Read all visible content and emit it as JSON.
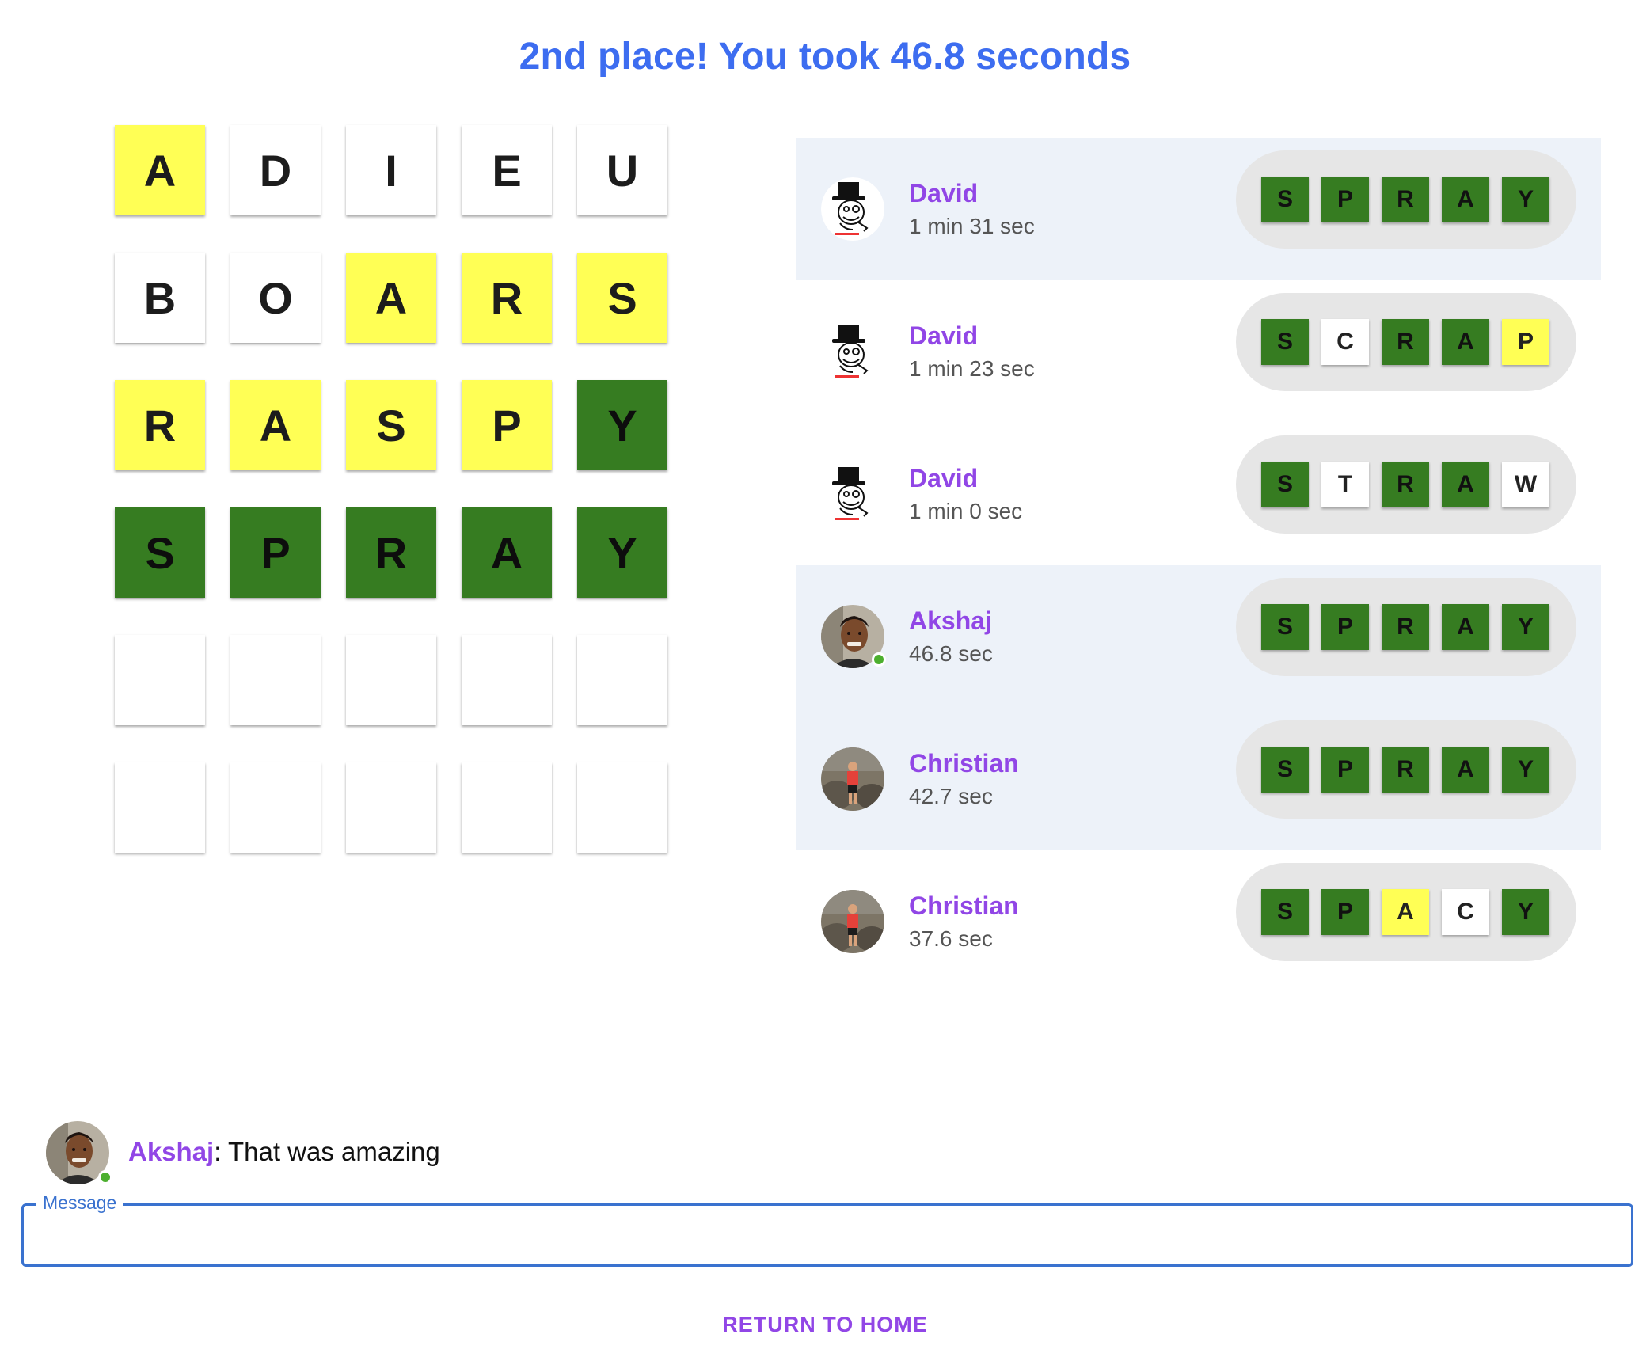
{
  "headline": "2nd place! You took 46.8 seconds",
  "board": [
    [
      {
        "l": "A",
        "s": "yellow"
      },
      {
        "l": "D",
        "s": "white"
      },
      {
        "l": "I",
        "s": "white"
      },
      {
        "l": "E",
        "s": "white"
      },
      {
        "l": "U",
        "s": "white"
      }
    ],
    [
      {
        "l": "B",
        "s": "white"
      },
      {
        "l": "O",
        "s": "white"
      },
      {
        "l": "A",
        "s": "yellow"
      },
      {
        "l": "R",
        "s": "yellow"
      },
      {
        "l": "S",
        "s": "yellow"
      }
    ],
    [
      {
        "l": "R",
        "s": "yellow"
      },
      {
        "l": "A",
        "s": "yellow"
      },
      {
        "l": "S",
        "s": "yellow"
      },
      {
        "l": "P",
        "s": "yellow"
      },
      {
        "l": "Y",
        "s": "green"
      }
    ],
    [
      {
        "l": "S",
        "s": "green"
      },
      {
        "l": "P",
        "s": "green"
      },
      {
        "l": "R",
        "s": "green"
      },
      {
        "l": "A",
        "s": "green"
      },
      {
        "l": "Y",
        "s": "green"
      }
    ],
    [
      {
        "l": "",
        "s": "white"
      },
      {
        "l": "",
        "s": "white"
      },
      {
        "l": "",
        "s": "white"
      },
      {
        "l": "",
        "s": "white"
      },
      {
        "l": "",
        "s": "white"
      }
    ],
    [
      {
        "l": "",
        "s": "white"
      },
      {
        "l": "",
        "s": "white"
      },
      {
        "l": "",
        "s": "white"
      },
      {
        "l": "",
        "s": "white"
      },
      {
        "l": "",
        "s": "white"
      }
    ]
  ],
  "results": [
    {
      "name": "David",
      "time": "1 min 31 sec",
      "avatar": "meme-avatar",
      "online": false,
      "highlight": true,
      "tiles": [
        {
          "l": "S",
          "s": "green"
        },
        {
          "l": "P",
          "s": "green"
        },
        {
          "l": "R",
          "s": "green"
        },
        {
          "l": "A",
          "s": "green"
        },
        {
          "l": "Y",
          "s": "green"
        }
      ]
    },
    {
      "name": "David",
      "time": "1 min 23 sec",
      "avatar": "meme-avatar",
      "online": false,
      "highlight": false,
      "tiles": [
        {
          "l": "S",
          "s": "green"
        },
        {
          "l": "C",
          "s": "white"
        },
        {
          "l": "R",
          "s": "green"
        },
        {
          "l": "A",
          "s": "green"
        },
        {
          "l": "P",
          "s": "yellow"
        }
      ]
    },
    {
      "name": "David",
      "time": "1 min 0 sec",
      "avatar": "meme-avatar",
      "online": false,
      "highlight": false,
      "tiles": [
        {
          "l": "S",
          "s": "green"
        },
        {
          "l": "T",
          "s": "white"
        },
        {
          "l": "R",
          "s": "green"
        },
        {
          "l": "A",
          "s": "green"
        },
        {
          "l": "W",
          "s": "white"
        }
      ]
    },
    {
      "name": "Akshaj",
      "time": "46.8 sec",
      "avatar": "photo-avatar-akshaj",
      "online": true,
      "highlight": true,
      "tiles": [
        {
          "l": "S",
          "s": "green"
        },
        {
          "l": "P",
          "s": "green"
        },
        {
          "l": "R",
          "s": "green"
        },
        {
          "l": "A",
          "s": "green"
        },
        {
          "l": "Y",
          "s": "green"
        }
      ]
    },
    {
      "name": "Christian",
      "time": "42.7 sec",
      "avatar": "photo-avatar-christian",
      "online": false,
      "highlight": true,
      "tiles": [
        {
          "l": "S",
          "s": "green"
        },
        {
          "l": "P",
          "s": "green"
        },
        {
          "l": "R",
          "s": "green"
        },
        {
          "l": "A",
          "s": "green"
        },
        {
          "l": "Y",
          "s": "green"
        }
      ]
    },
    {
      "name": "Christian",
      "time": "37.6 sec",
      "avatar": "photo-avatar-christian",
      "online": false,
      "highlight": false,
      "tiles": [
        {
          "l": "S",
          "s": "green"
        },
        {
          "l": "P",
          "s": "green"
        },
        {
          "l": "A",
          "s": "yellow"
        },
        {
          "l": "C",
          "s": "white"
        },
        {
          "l": "Y",
          "s": "green"
        }
      ]
    }
  ],
  "chat": {
    "author": "Akshaj",
    "separator": ":",
    "text": " That was amazing"
  },
  "message_field": {
    "label": "Message",
    "value": ""
  },
  "return_home": "RETURN TO HOME",
  "colors": {
    "accent_blue": "#3d6df0",
    "name_purple": "#9146e6",
    "tile_green": "#367c21",
    "tile_yellow": "#ffff55",
    "highlight_bg": "#edf2f9",
    "online_green": "#4caf2e"
  }
}
